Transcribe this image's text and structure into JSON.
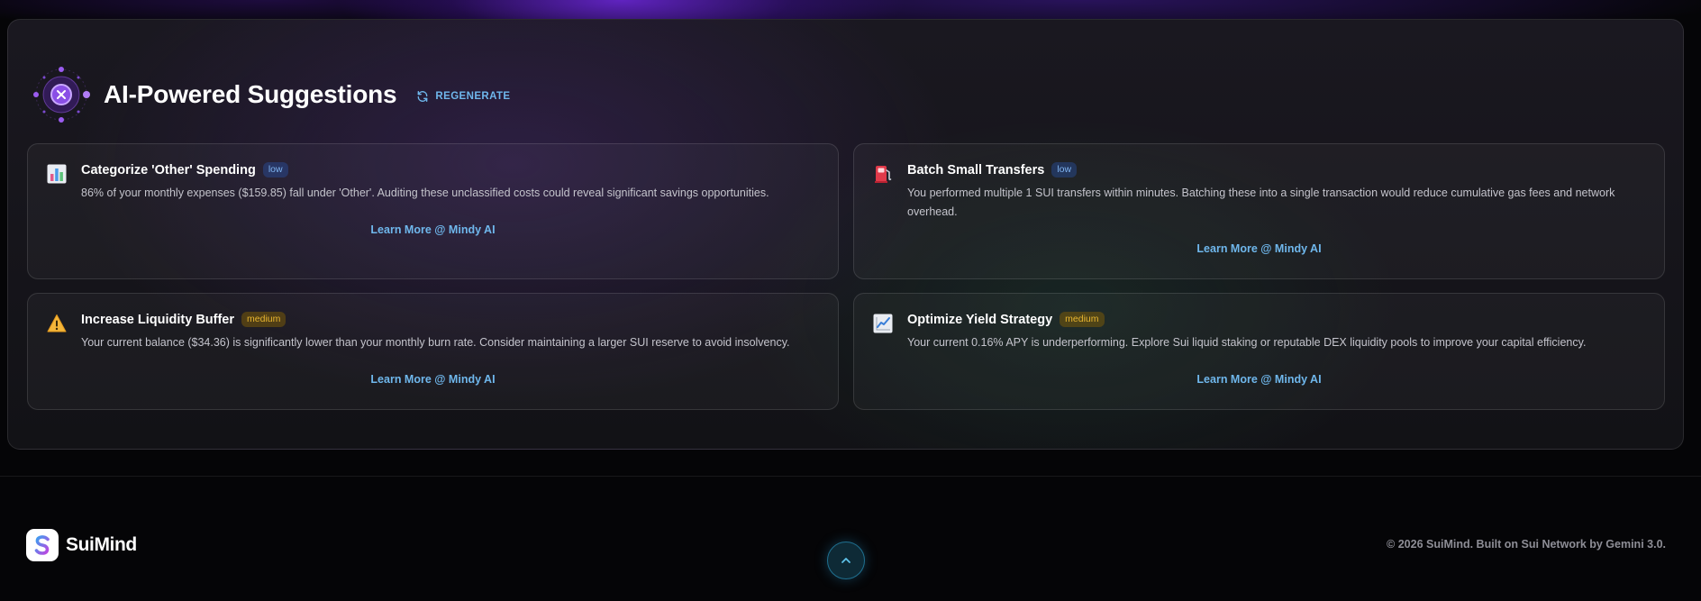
{
  "suggestions_panel": {
    "title": "AI-Powered Suggestions",
    "regenerate_label": "REGENERATE",
    "cards": [
      {
        "icon": "bar-chart-icon",
        "title": "Categorize 'Other' Spending",
        "priority": "low",
        "description": "86% of your monthly expenses ($159.85) fall under 'Other'. Auditing these unclassified costs could reveal significant savings opportunities.",
        "link": "Learn More @ Mindy AI"
      },
      {
        "icon": "fuel-pump-icon",
        "title": "Batch Small Transfers",
        "priority": "low",
        "description": "You performed multiple 1 SUI transfers within minutes. Batching these into a single transaction would reduce cumulative gas fees and network overhead.",
        "link": "Learn More @ Mindy AI"
      },
      {
        "icon": "warning-icon",
        "title": "Increase Liquidity Buffer",
        "priority": "medium",
        "description": "Your current balance ($34.36) is significantly lower than your monthly burn rate. Consider maintaining a larger SUI reserve to avoid insolvency.",
        "link": "Learn More @ Mindy AI"
      },
      {
        "icon": "trend-chart-icon",
        "title": "Optimize Yield Strategy",
        "priority": "medium",
        "description": "Your current 0.16% APY is underperforming. Explore Sui liquid staking or reputable DEX liquidity pools to improve your capital efficiency.",
        "link": "Learn More @ Mindy AI"
      }
    ]
  },
  "footer": {
    "brand_name": "SuiMind",
    "copyright": "© 2026 SuiMind. Built on Sui Network by Gemini 3.0."
  },
  "colors": {
    "accent": "#6fb7ec",
    "badge_low": "#7fb4f0",
    "badge_medium": "#e8b630",
    "ai_purple": "#9b5cf0"
  }
}
